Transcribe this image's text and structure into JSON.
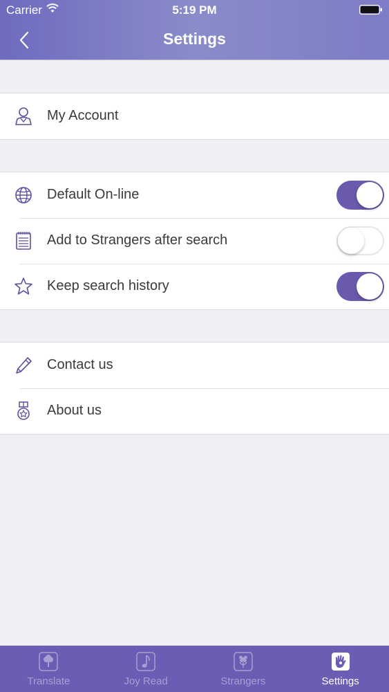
{
  "status_bar": {
    "carrier": "Carrier",
    "time": "5:19 PM"
  },
  "nav": {
    "title": "Settings",
    "back_icon": "chevron-left-icon"
  },
  "groups": [
    {
      "rows": [
        {
          "label": "My Account",
          "icon": "user-icon"
        }
      ]
    },
    {
      "rows": [
        {
          "label": "Default On-line",
          "icon": "globe-icon",
          "toggle": true
        },
        {
          "label": "Add to Strangers after search",
          "icon": "notepad-icon",
          "toggle": false
        },
        {
          "label": "Keep search history",
          "icon": "star-icon",
          "toggle": true
        }
      ]
    },
    {
      "rows": [
        {
          "label": "Contact us",
          "icon": "pencil-icon"
        },
        {
          "label": "About us",
          "icon": "medal-icon"
        }
      ]
    }
  ],
  "tab_bar": {
    "tabs": [
      {
        "label": "Translate",
        "icon": "tree-icon",
        "active": false
      },
      {
        "label": "Joy Read",
        "icon": "music-note-icon",
        "active": false
      },
      {
        "label": "Strangers",
        "icon": "flower-icon",
        "active": false
      },
      {
        "label": "Settings",
        "icon": "hand-icon",
        "active": true
      }
    ]
  },
  "colors": {
    "accent": "#6b59ad",
    "tab_bar": "#6c5cb3",
    "background": "#efeff4"
  }
}
